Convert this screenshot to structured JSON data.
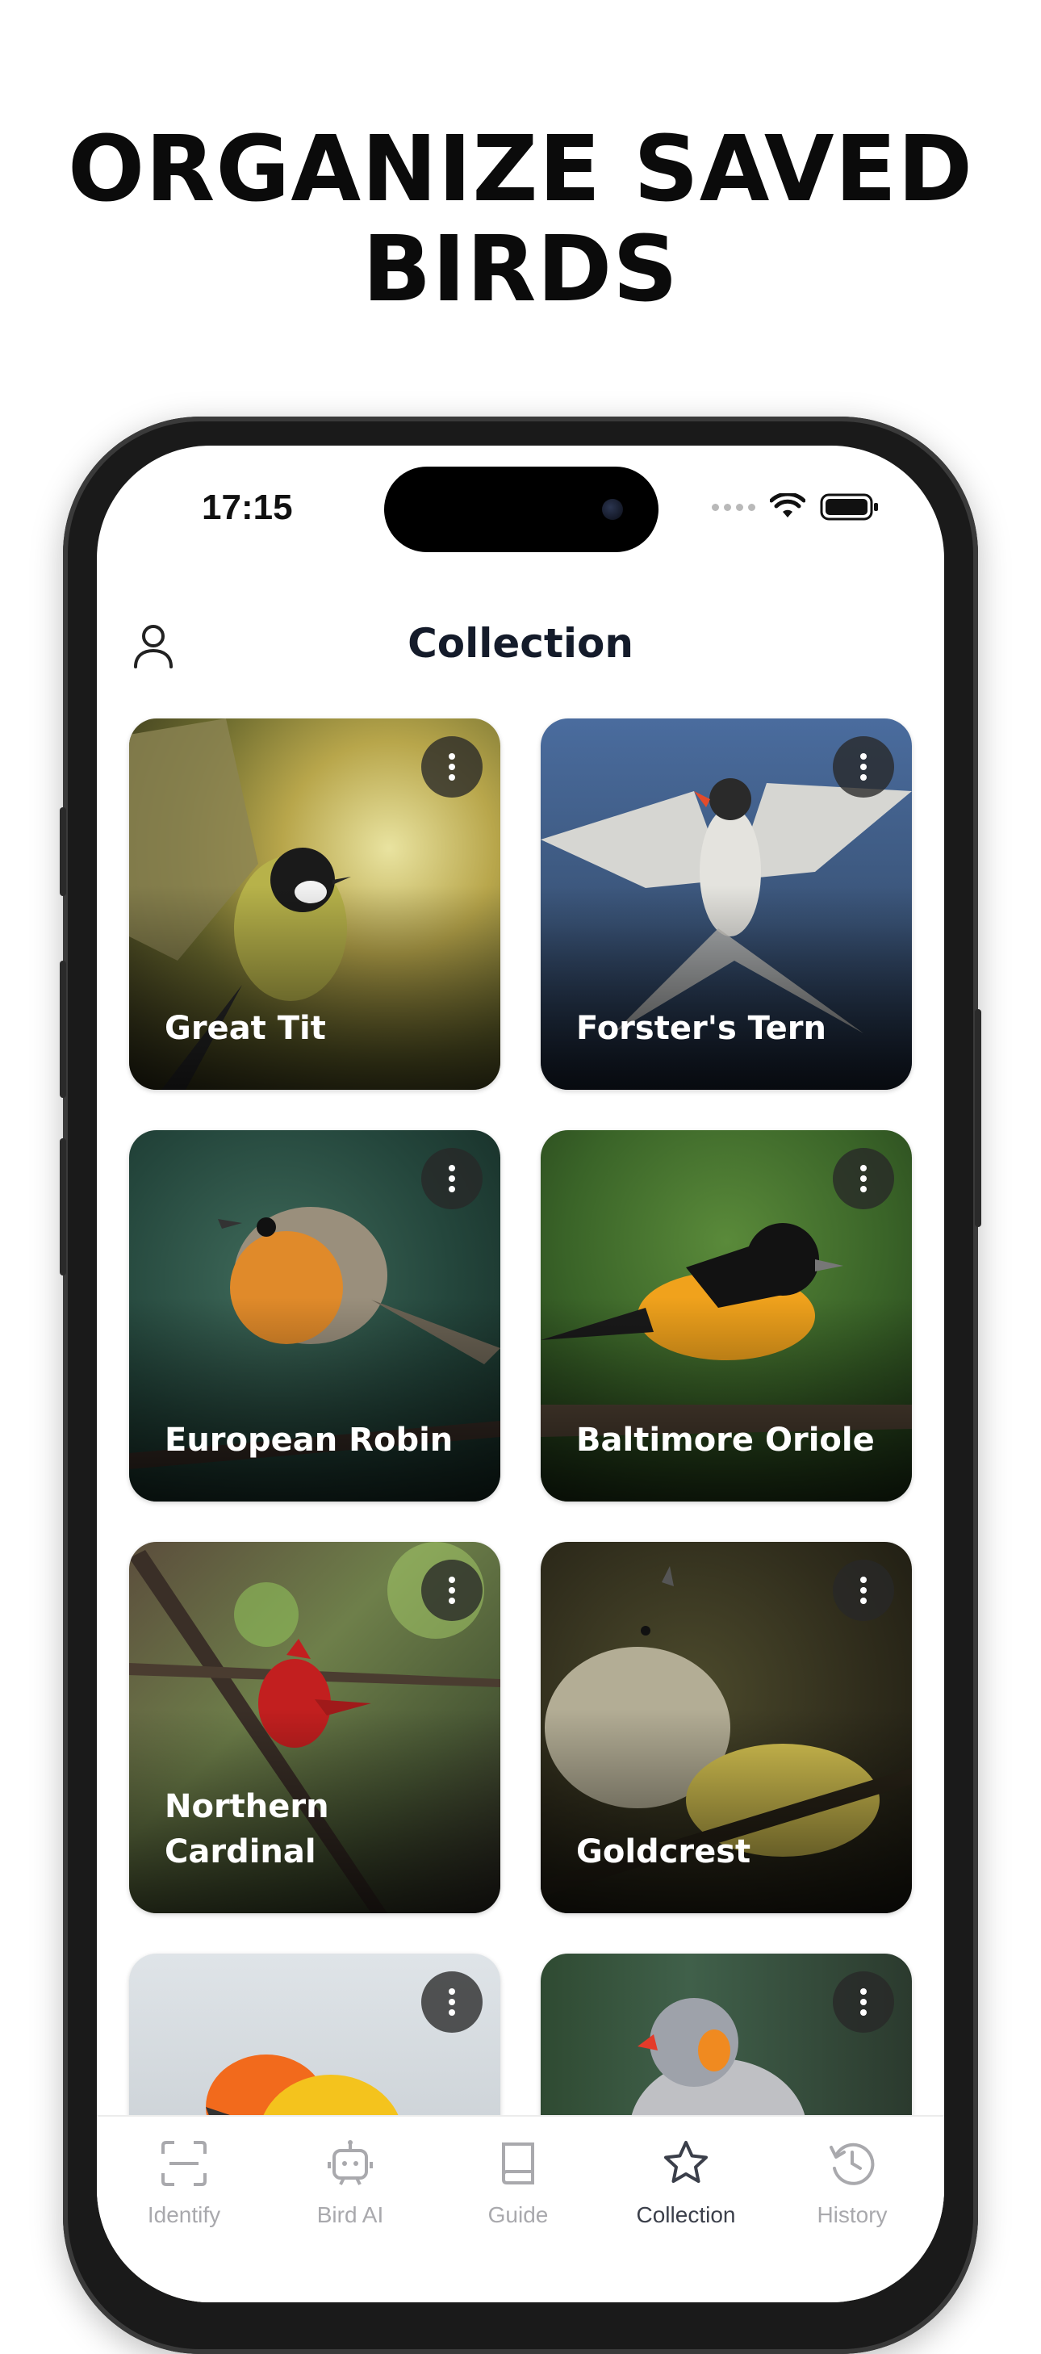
{
  "headline": {
    "line1": "ORGANIZE SAVED",
    "line2": "BIRDS"
  },
  "status_bar": {
    "time": "17:15"
  },
  "header": {
    "title": "Collection"
  },
  "birds": [
    {
      "name": "Great Tit"
    },
    {
      "name": "Forster's Tern"
    },
    {
      "name": "European Robin"
    },
    {
      "name": "Baltimore Oriole"
    },
    {
      "name": "Northern Cardinal"
    },
    {
      "name": "Goldcrest"
    },
    {
      "name": ""
    },
    {
      "name": ""
    }
  ],
  "tabs": [
    {
      "label": "Identify",
      "icon": "scan-icon",
      "active": false
    },
    {
      "label": "Bird AI",
      "icon": "robot-icon",
      "active": false
    },
    {
      "label": "Guide",
      "icon": "book-icon",
      "active": false
    },
    {
      "label": "Collection",
      "icon": "star-icon",
      "active": true
    },
    {
      "label": "History",
      "icon": "history-icon",
      "active": false
    }
  ],
  "colors": {
    "title": "#141b2a",
    "tab_inactive": "#a9a9ad",
    "tab_active": "#3b3f4a"
  }
}
